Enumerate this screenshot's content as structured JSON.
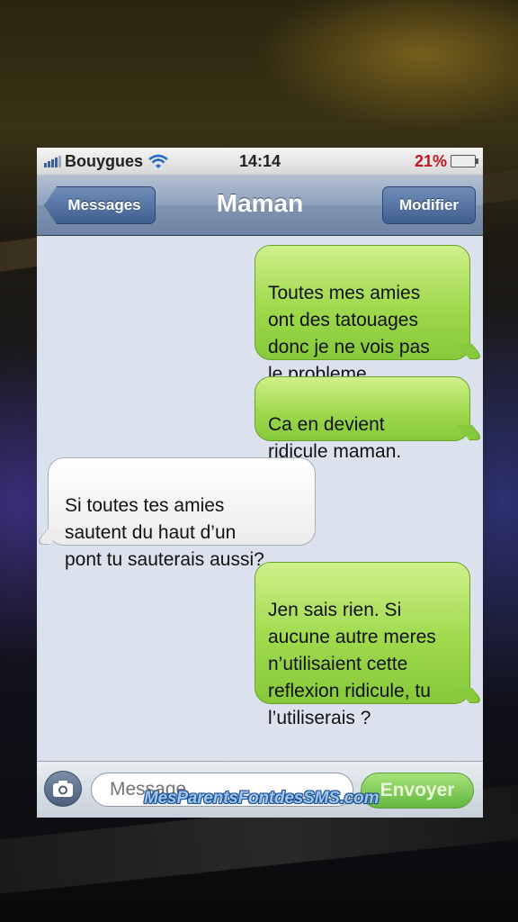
{
  "status_bar": {
    "carrier": "Bouygues",
    "time": "14:14",
    "battery_percent": "21%",
    "battery_level": 0.21,
    "icons": [
      "signal-bars-icon",
      "wifi-icon",
      "battery-icon"
    ]
  },
  "nav": {
    "back_label": "Messages",
    "title": "Maman",
    "edit_label": "Modifier"
  },
  "messages": [
    {
      "direction": "out",
      "text": "Toutes mes amies\nont des tatouages\ndonc je ne vois pas\nle probleme..."
    },
    {
      "direction": "out",
      "text": "Ca en devient\nridicule maman."
    },
    {
      "direction": "in",
      "text": "Si toutes tes amies\nsautent du haut d’un\npont tu sauterais aussi?"
    },
    {
      "direction": "out",
      "text": "Jen sais rien. Si\naucune autre meres\nn’utilisaient cette\nreflexion ridicule, tu\nl’utiliserais ?"
    }
  ],
  "input": {
    "placeholder": "Message",
    "send_label": "Envoyer"
  },
  "watermark": "MesParentsFontdesSMS.com",
  "colors": {
    "outgoing_bubble": "#9fd94d",
    "incoming_bubble": "#ffffff",
    "nav_bar": "#8ea2bc",
    "battery_low": "#c0161c",
    "send_button": "#63b73f"
  }
}
